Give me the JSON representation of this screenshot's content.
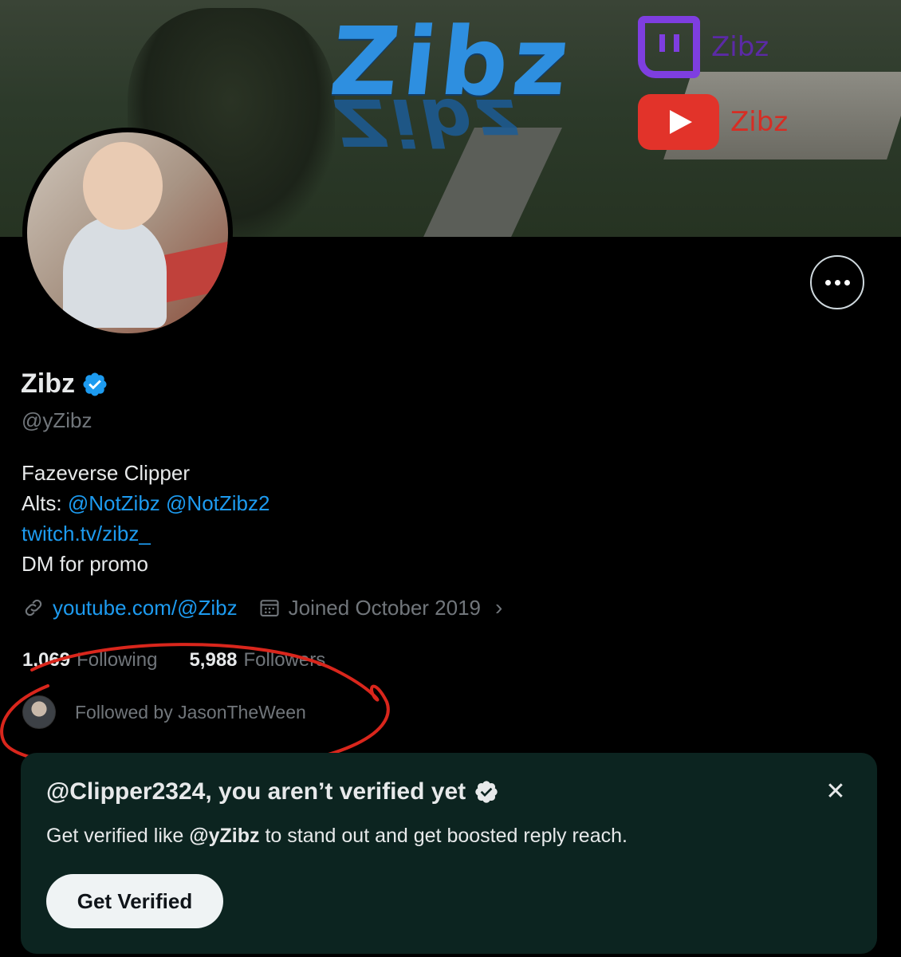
{
  "banner": {
    "logo_text": "Zibz",
    "twitch_name": "Zibz",
    "youtube_name": "Zibz"
  },
  "profile": {
    "display_name": "Zibz",
    "handle": "@yZibz",
    "bio": {
      "line1": "Fazeverse Clipper",
      "alts_label": "Alts:",
      "alt1": "@NotZibz",
      "alt2": "@NotZibz2",
      "link": "twitch.tv/zibz_",
      "line4": "DM for promo"
    },
    "website": "youtube.com/@Zibz",
    "joined": "Joined October 2019",
    "following_count": "1,069",
    "following_label": "Following",
    "followers_count": "5,988",
    "followers_label": "Followers",
    "followed_by": "Followed by JasonTheWeen"
  },
  "promo": {
    "title": "@Clipper2324, you aren’t verified yet",
    "body_prefix": "Get verified like",
    "body_handle": "@yZibz",
    "body_suffix": "to stand out and get boosted reply reach.",
    "button_label": "Get Verified",
    "close_glyph": "✕"
  },
  "colors": {
    "background": "#000000",
    "accent_blue": "#1d9bf0",
    "secondary_text": "#71767b",
    "promo_bg": "#0c2420",
    "annotation_red": "#d9261c"
  },
  "icons": {
    "more": "more-icon",
    "verified": "verified-badge-icon",
    "link": "link-icon",
    "calendar": "calendar-icon",
    "close": "close-icon"
  }
}
